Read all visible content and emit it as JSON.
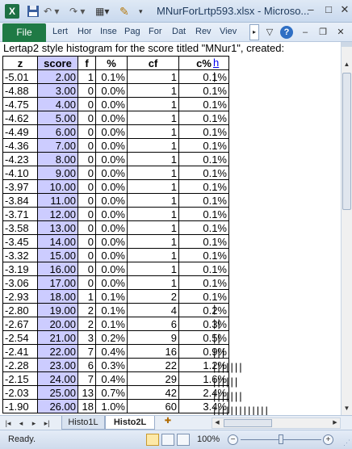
{
  "window": {
    "title": "MNurForLrtp593.xlsx - Microso...",
    "app_logo": "X",
    "min_glyph": "–",
    "max_glyph": "□",
    "close_glyph": "✕"
  },
  "qat": {
    "save_icon": "save-icon",
    "undo_glyph": "↶ ▾",
    "redo_glyph": "↷ ▾",
    "layout_glyph": "▦▾",
    "brush_glyph": "✎",
    "more_glyph": "▾"
  },
  "ribbon": {
    "file_label": "File",
    "tabs": [
      "Lert",
      "Hor",
      "Inse",
      "Pag",
      "For",
      "Dat",
      "Rev",
      "Viev"
    ],
    "overflow_glyph": "▸",
    "right_icons": [
      "▽",
      "?",
      "–",
      "❐",
      "✕"
    ],
    "help_glyph": "?"
  },
  "sheet": {
    "caption": "Lertap2 style histogram for the score titled \"MNur1\", created:",
    "link_text": "h",
    "headers": [
      "z",
      "score",
      "f",
      "%",
      "cf",
      "c%"
    ],
    "rows": [
      {
        "z": "-5.01",
        "score": "2.00",
        "f": "1",
        "pct": "0.1%",
        "cf": "1",
        "cpct": "0.1%",
        "bars": "|"
      },
      {
        "z": "-4.88",
        "score": "3.00",
        "f": "0",
        "pct": "0.0%",
        "cf": "1",
        "cpct": "0.1%",
        "bars": ""
      },
      {
        "z": "-4.75",
        "score": "4.00",
        "f": "0",
        "pct": "0.0%",
        "cf": "1",
        "cpct": "0.1%",
        "bars": ""
      },
      {
        "z": "-4.62",
        "score": "5.00",
        "f": "0",
        "pct": "0.0%",
        "cf": "1",
        "cpct": "0.1%",
        "bars": ""
      },
      {
        "z": "-4.49",
        "score": "6.00",
        "f": "0",
        "pct": "0.0%",
        "cf": "1",
        "cpct": "0.1%",
        "bars": ""
      },
      {
        "z": "-4.36",
        "score": "7.00",
        "f": "0",
        "pct": "0.0%",
        "cf": "1",
        "cpct": "0.1%",
        "bars": ""
      },
      {
        "z": "-4.23",
        "score": "8.00",
        "f": "0",
        "pct": "0.0%",
        "cf": "1",
        "cpct": "0.1%",
        "bars": ""
      },
      {
        "z": "-4.10",
        "score": "9.00",
        "f": "0",
        "pct": "0.0%",
        "cf": "1",
        "cpct": "0.1%",
        "bars": ""
      },
      {
        "z": "-3.97",
        "score": "10.00",
        "f": "0",
        "pct": "0.0%",
        "cf": "1",
        "cpct": "0.1%",
        "bars": ""
      },
      {
        "z": "-3.84",
        "score": "11.00",
        "f": "0",
        "pct": "0.0%",
        "cf": "1",
        "cpct": "0.1%",
        "bars": ""
      },
      {
        "z": "-3.71",
        "score": "12.00",
        "f": "0",
        "pct": "0.0%",
        "cf": "1",
        "cpct": "0.1%",
        "bars": ""
      },
      {
        "z": "-3.58",
        "score": "13.00",
        "f": "0",
        "pct": "0.0%",
        "cf": "1",
        "cpct": "0.1%",
        "bars": ""
      },
      {
        "z": "-3.45",
        "score": "14.00",
        "f": "0",
        "pct": "0.0%",
        "cf": "1",
        "cpct": "0.1%",
        "bars": ""
      },
      {
        "z": "-3.32",
        "score": "15.00",
        "f": "0",
        "pct": "0.0%",
        "cf": "1",
        "cpct": "0.1%",
        "bars": ""
      },
      {
        "z": "-3.19",
        "score": "16.00",
        "f": "0",
        "pct": "0.0%",
        "cf": "1",
        "cpct": "0.1%",
        "bars": ""
      },
      {
        "z": "-3.06",
        "score": "17.00",
        "f": "0",
        "pct": "0.0%",
        "cf": "1",
        "cpct": "0.1%",
        "bars": ""
      },
      {
        "z": "-2.93",
        "score": "18.00",
        "f": "1",
        "pct": "0.1%",
        "cf": "2",
        "cpct": "0.1%",
        "bars": "|"
      },
      {
        "z": "-2.80",
        "score": "19.00",
        "f": "2",
        "pct": "0.1%",
        "cf": "4",
        "cpct": "0.2%",
        "bars": "||"
      },
      {
        "z": "-2.67",
        "score": "20.00",
        "f": "2",
        "pct": "0.1%",
        "cf": "6",
        "cpct": "0.3%",
        "bars": "||"
      },
      {
        "z": "-2.54",
        "score": "21.00",
        "f": "3",
        "pct": "0.2%",
        "cf": "9",
        "cpct": "0.5%",
        "bars": "|||"
      },
      {
        "z": "-2.41",
        "score": "22.00",
        "f": "7",
        "pct": "0.4%",
        "cf": "16",
        "cpct": "0.9%",
        "bars": "|||||||"
      },
      {
        "z": "-2.28",
        "score": "23.00",
        "f": "6",
        "pct": "0.3%",
        "cf": "22",
        "cpct": "1.2%",
        "bars": "||||||"
      },
      {
        "z": "-2.15",
        "score": "24.00",
        "f": "7",
        "pct": "0.4%",
        "cf": "29",
        "cpct": "1.6%",
        "bars": "|||||||"
      },
      {
        "z": "-2.03",
        "score": "25.00",
        "f": "13",
        "pct": "0.7%",
        "cf": "42",
        "cpct": "2.4%",
        "bars": "|||||||||||||"
      },
      {
        "z": "-1.90",
        "score": "26.00",
        "f": "18",
        "pct": "1.0%",
        "cf": "60",
        "cpct": "3.4%",
        "bars": "||||||||||||||||||"
      }
    ]
  },
  "tabs": {
    "nav_glyphs": [
      "|◂",
      "◂",
      "▸",
      "▸|"
    ],
    "sheets": [
      {
        "label": "Histo1L",
        "active": false
      },
      {
        "label": "Histo2L",
        "active": true
      }
    ],
    "new_sheet_glyph": "✚"
  },
  "status": {
    "text": "Ready.",
    "zoom": "100%",
    "zoom_level_percent": 100,
    "zoom_minus": "−",
    "zoom_plus": "+"
  },
  "colors": {
    "score_column": "#ccccff",
    "file_tab": "#1f7a45"
  }
}
